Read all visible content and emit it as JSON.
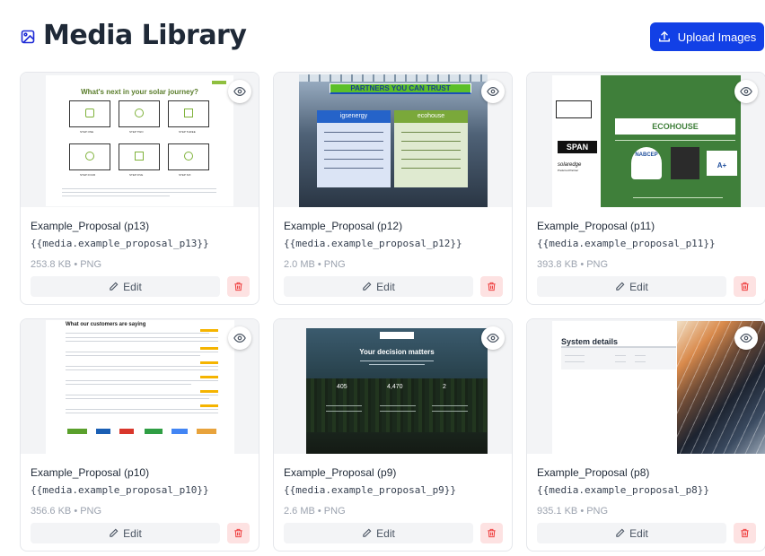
{
  "header": {
    "title": "Media Library",
    "upload_label": "Upload Images",
    "accent_color": "#1240e6"
  },
  "cards": [
    {
      "name": "Example_Proposal (p13)",
      "variable": "{{media.example_proposal_p13}}",
      "meta": "253.8 KB • PNG",
      "edit_label": "Edit",
      "thumb_text": {
        "heading": "What's next in your solar journey?",
        "steps": [
          "STEP ONE",
          "STEP TWO",
          "STEP THREE",
          "STEP FOUR",
          "STEP FIVE",
          "STEP SIX"
        ]
      }
    },
    {
      "name": "Example_Proposal (p12)",
      "variable": "{{media.example_proposal_p12}}",
      "meta": "2.0 MB • PNG",
      "edit_label": "Edit",
      "thumb_text": {
        "banner": "PARTNERS YOU CAN TRUST",
        "left_brand": "igsenergy",
        "right_brand": "ecohouse"
      }
    },
    {
      "name": "Example_Proposal (p11)",
      "variable": "{{media.example_proposal_p11}}",
      "meta": "393.8 KB • PNG",
      "edit_label": "Edit",
      "thumb_text": {
        "span_logo": "SPAN",
        "solaredge": "solaredge",
        "solaredge_sub": "Preferred Partner",
        "brand": "ECOHOUSE",
        "nabcep": "NABCEP",
        "bbb": "A+"
      }
    },
    {
      "name": "Example_Proposal (p10)",
      "variable": "{{media.example_proposal_p10}}",
      "meta": "356.6 KB • PNG",
      "edit_label": "Edit",
      "thumb_text": {
        "heading": "What our customers are saying"
      }
    },
    {
      "name": "Example_Proposal (p9)",
      "variable": "{{media.example_proposal_p9}}",
      "meta": "2.6 MB • PNG",
      "edit_label": "Edit",
      "thumb_text": {
        "heading": "Your decision matters",
        "stats": [
          "405",
          "4,470",
          "2"
        ]
      }
    },
    {
      "name": "Example_Proposal (p8)",
      "variable": "{{media.example_proposal_p8}}",
      "meta": "935.1 KB • PNG",
      "edit_label": "Edit",
      "thumb_text": {
        "heading": "System details"
      }
    }
  ]
}
